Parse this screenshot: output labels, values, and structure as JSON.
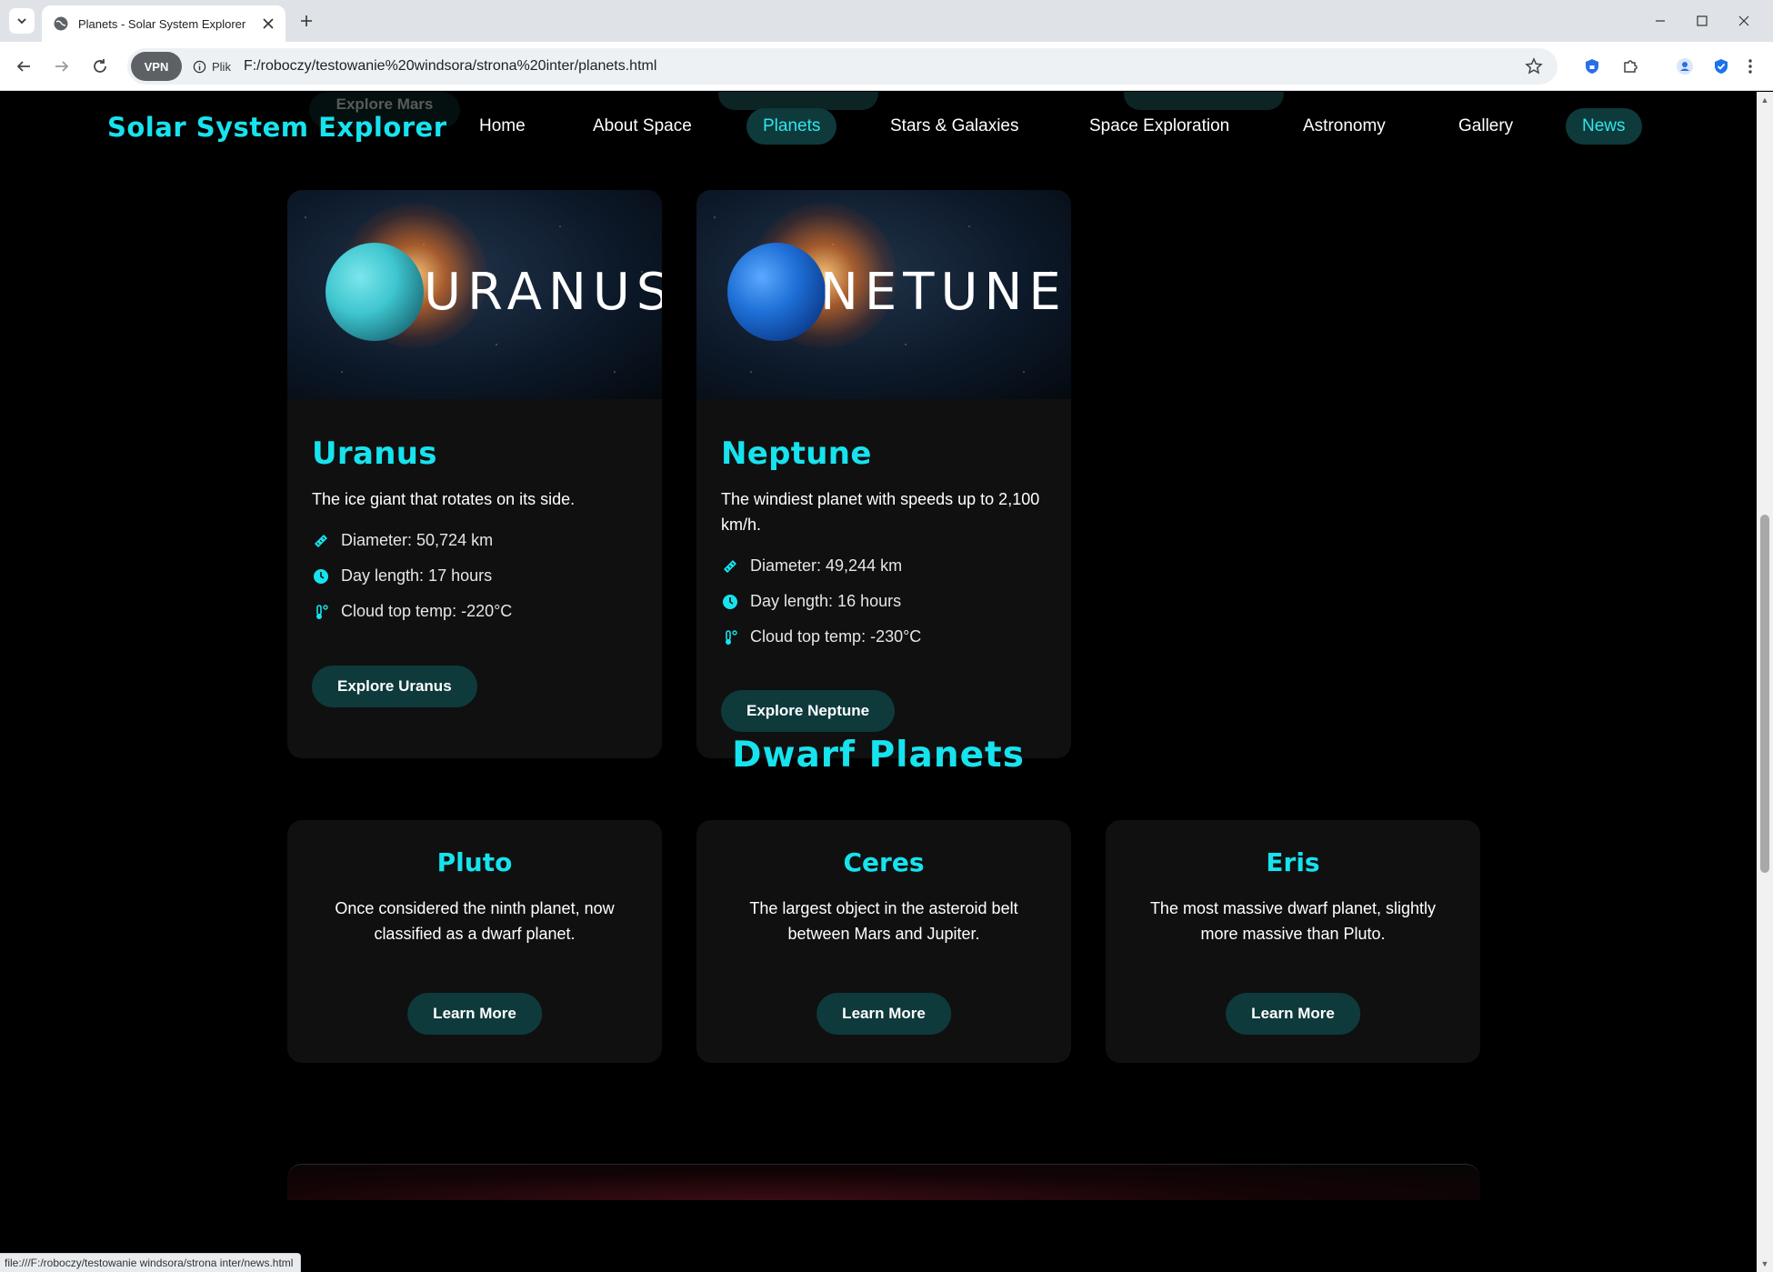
{
  "browser": {
    "tab_title": "Planets - Solar System Explorer",
    "vpn_label": "VPN",
    "site_info_label": "Plik",
    "url": "F:/roboczy/testowanie%20windsora/strona%20inter/planets.html",
    "status_url": "file:///F:/roboczy/testowanie windsora/strona inter/news.html"
  },
  "site": {
    "logo": "Solar System Explorer",
    "nav": [
      "Home",
      "About Space",
      "Planets",
      "Stars & Galaxies",
      "Space Exploration",
      "Astronomy",
      "Gallery",
      "News"
    ],
    "partial_button": "Explore Mars"
  },
  "planets": [
    {
      "image_word": "URANUS",
      "name": "Uranus",
      "description": "The ice giant that rotates on its side.",
      "facts": [
        "Diameter: 50,724 km",
        "Day length: 17 hours",
        "Cloud top temp: -220°C"
      ],
      "button": "Explore Uranus",
      "planet_color": "#3fc6cf"
    },
    {
      "image_word": "NETUNE",
      "name": "Neptune",
      "description": "The windiest planet with speeds up to 2,100 km/h.",
      "facts": [
        "Diameter: 49,244 km",
        "Day length: 16 hours",
        "Cloud top temp: -230°C"
      ],
      "button": "Explore Neptune",
      "planet_color": "#1e6fd6"
    }
  ],
  "dwarf_section": {
    "title": "Dwarf Planets",
    "items": [
      {
        "name": "Pluto",
        "description": "Once considered the ninth planet, now classified as a dwarf planet.",
        "button": "Learn More"
      },
      {
        "name": "Ceres",
        "description": "The largest object in the asteroid belt between Mars and Jupiter.",
        "button": "Learn More"
      },
      {
        "name": "Eris",
        "description": "The most massive dwarf planet, slightly more massive than Pluto.",
        "button": "Learn More"
      }
    ]
  },
  "colors": {
    "accent": "#16e3ee",
    "button_bg": "#0e3a3c",
    "card_bg": "#101010",
    "page_bg": "#000000"
  }
}
